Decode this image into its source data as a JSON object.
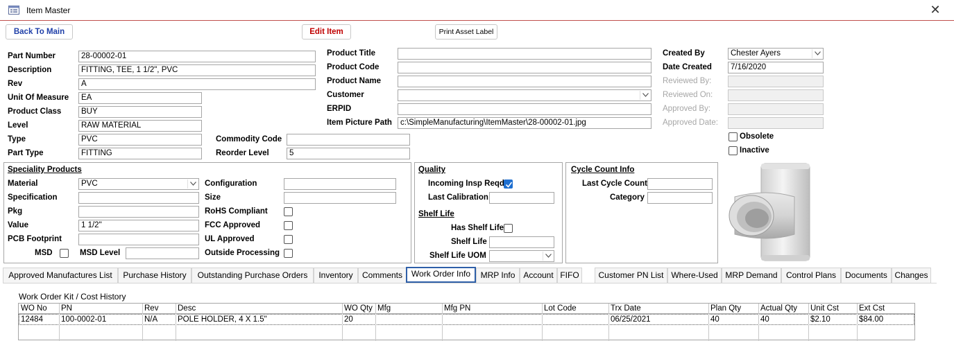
{
  "window": {
    "title": "Item Master",
    "close_glyph": "✕"
  },
  "toolbar": {
    "back_label": "Back To Main",
    "edit_label": "Edit Item",
    "print_label": "Print Asset Label"
  },
  "item": {
    "part_number_label": "Part Number",
    "part_number": "28-00002-01",
    "description_label": "Description",
    "description": "FITTING, TEE, 1 1/2\", PVC",
    "rev_label": "Rev",
    "rev": "A",
    "uom_label": "Unit Of Measure",
    "uom": "EA",
    "product_class_label": "Product Class",
    "product_class": "BUY",
    "level_label": "Level",
    "level": "RAW MATERIAL",
    "type_label": "Type",
    "type": "PVC",
    "part_type_label": "Part Type",
    "part_type": "FITTING",
    "commodity_code_label": "Commodity Code",
    "commodity_code": "",
    "reorder_level_label": "Reorder Level",
    "reorder_level": "5",
    "product_title_label": "Product Title",
    "product_title": "",
    "product_code_label": "Product Code",
    "product_code": "",
    "product_name_label": "Product Name",
    "product_name": "",
    "customer_label": "Customer",
    "customer": "",
    "erpid_label": "ERPID",
    "erpid": "",
    "picture_path_label": "Item Picture Path",
    "picture_path": "c:\\SimpleManufacturing\\ItemMaster\\28-00002-01.jpg"
  },
  "audit": {
    "created_by_label": "Created By",
    "created_by": "Chester Ayers",
    "date_created_label": "Date Created",
    "date_created": "7/16/2020",
    "reviewed_by_label": "Reviewed By:",
    "reviewed_by": "",
    "reviewed_on_label": "Reviewed On:",
    "reviewed_on": "",
    "approved_by_label": "Approved By:",
    "approved_by": "",
    "approved_date_label": "Approved Date:",
    "approved_date": "",
    "obsolete_label": "Obsolete",
    "obsolete": false,
    "inactive_label": "Inactive",
    "inactive": false
  },
  "speciality": {
    "heading": "Speciality Products",
    "material_label": "Material",
    "material": "PVC",
    "specification_label": "Specification",
    "specification": "",
    "pkg_label": "Pkg",
    "pkg": "",
    "value_label": "Value",
    "value": "1 1/2\"",
    "pcb_label": "PCB Footprint",
    "pcb": "",
    "msd_label": "MSD",
    "msd": false,
    "msd_level_label": "MSD Level",
    "msd_level": "",
    "configuration_label": "Configuration",
    "configuration": "",
    "size_label": "Size",
    "size": "",
    "rohs_label": "RoHS Compliant",
    "rohs": false,
    "fcc_label": "FCC Approved",
    "fcc": false,
    "ul_label": "UL Approved",
    "ul": false,
    "outside_label": "Outside Processing",
    "outside": false
  },
  "quality": {
    "heading": "Quality",
    "incoming_label": "Incoming Insp Reqd",
    "incoming": true,
    "last_cal_label": "Last Calibration",
    "last_cal": "",
    "shelf_heading": "Shelf Life",
    "has_shelf_label": "Has Shelf Life",
    "has_shelf": false,
    "shelf_life_label": "Shelf Life",
    "shelf_life": "",
    "shelf_uom_label": "Shelf Life UOM",
    "shelf_uom": ""
  },
  "cycle": {
    "heading": "Cycle Count Info",
    "last_label": "Last Cycle Count",
    "last": "",
    "category_label": "Category",
    "category": ""
  },
  "tabs": [
    "Approved Manufactures List",
    "Purchase History",
    "Outstanding Purchase Orders",
    "Inventory",
    "Comments",
    "Work Order Info",
    "MRP Info",
    "Account",
    "FIFO",
    "Customer PN List",
    "Where-Used",
    "MRP Demand",
    "Control Plans",
    "Documents",
    "Changes"
  ],
  "active_tab": "Work Order Info",
  "work_order": {
    "section_title": "Work Order Kit / Cost History",
    "columns": [
      "WO No",
      "PN",
      "Rev",
      "Desc",
      "WO Qty",
      "Mfg",
      "Mfg PN",
      "Lot Code",
      "Trx Date",
      "Plan Qty",
      "Actual Qty",
      "Unit Cst",
      "Ext Cst"
    ],
    "rows": [
      [
        "12484",
        "100-0002-01",
        "N/A",
        "POLE HOLDER, 4 X 1.5\"",
        "20",
        "",
        "",
        "",
        "06/25/2021",
        "40",
        "40",
        "$2.10",
        "$84.00"
      ]
    ]
  },
  "colors": {
    "accent_red": "#c0504d",
    "link_blue": "#1f3fa8",
    "edit_red": "#c00000",
    "tab_active": "#2e5fa8",
    "check_blue": "#1e6fd0"
  },
  "icons": {
    "title_icon": "form-icon",
    "dropdown": "chevron-down-icon",
    "check": "checkmark-icon"
  }
}
